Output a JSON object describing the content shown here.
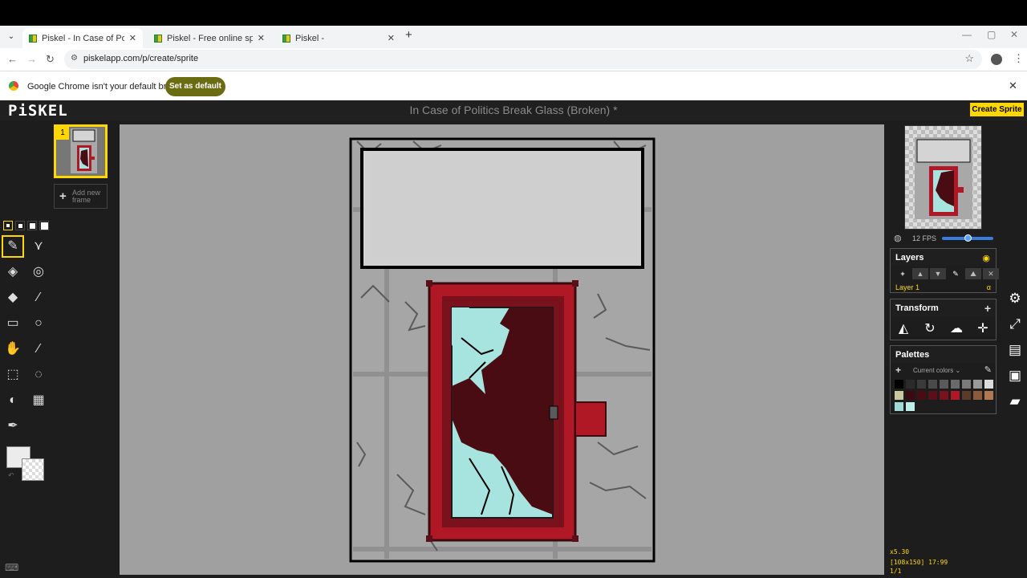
{
  "browser": {
    "tabs": [
      {
        "title": "Piskel - In Case of Politics Break",
        "active": true
      },
      {
        "title": "Piskel - Free online sprite editor",
        "active": false
      },
      {
        "title": "Piskel -",
        "active": false
      }
    ],
    "url": "piskelapp.com/p/create/sprite",
    "infobar_message": "Google Chrome isn't your default browser",
    "set_default_label": "Set as default"
  },
  "app": {
    "logo": "PiSKEL",
    "sprite_title": "In Case of Politics Break Glass (Broken) *",
    "create_sprite_label": "Create Sprite"
  },
  "frames": {
    "current_index": "1",
    "add_frame_label": "Add new frame"
  },
  "preview": {
    "fps_label": "12 FPS",
    "fps_value": 12
  },
  "layers": {
    "title": "Layers",
    "items": [
      {
        "name": "Layer 1",
        "alpha_symbol": "α"
      }
    ]
  },
  "transform": {
    "title": "Transform"
  },
  "palettes": {
    "title": "Palettes",
    "selected": "Current colors",
    "colors": [
      "#000000",
      "#2b2b2b",
      "#3a3a3a",
      "#4a4a4a",
      "#5a5a5a",
      "#6a6a6a",
      "#7a7a7a",
      "#9a9a9a",
      "#dcdcdc",
      "#c9c9a0",
      "#3a0a0f",
      "#4a0c13",
      "#5c0f18",
      "#7a121d",
      "#b01826",
      "#5a3a2a",
      "#8a5a3a",
      "#b07850",
      "#9fd9d4",
      "#bfeee9"
    ]
  },
  "status": {
    "zoom": "x5.30",
    "size_and_cursor": "[108x150] 17:99",
    "frame_count": "1/1"
  },
  "colors": {
    "accent": "#ffd700",
    "app_bg": "#1d1d1d",
    "canvas_bg": "#a0a0a0",
    "door_red": "#b01826",
    "glass": "#a8e4df"
  }
}
